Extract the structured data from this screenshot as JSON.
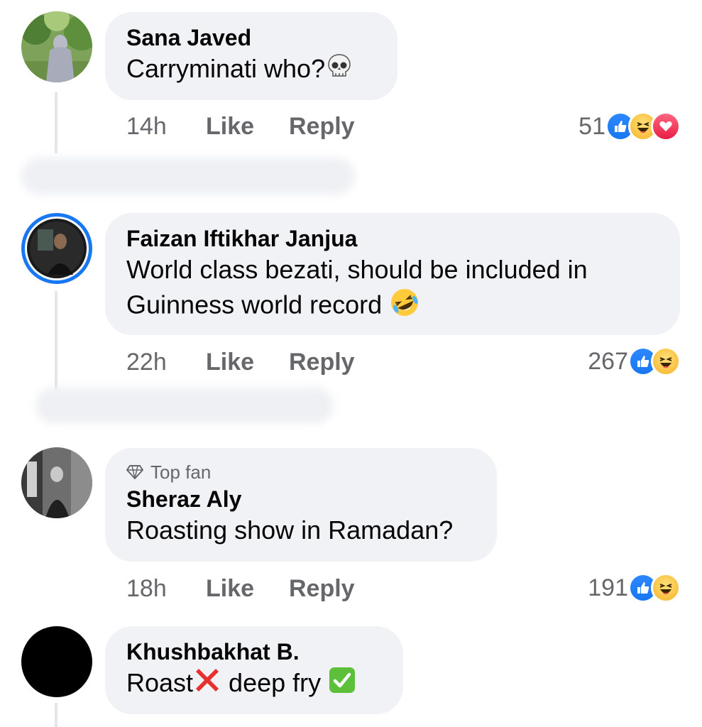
{
  "comments": [
    {
      "author": "Sana Javed",
      "text": "Carryminati who?",
      "text_emoji": "skull-emoji",
      "time": "14h",
      "like_label": "Like",
      "reply_label": "Reply",
      "reaction_count": "51",
      "reactions": [
        "like",
        "haha",
        "love"
      ]
    },
    {
      "author": "Faizan Iftikhar Janjua",
      "text_line1": "World class bezati, should be included in",
      "text_line2": "Guinness world record",
      "text_emoji": "rolling-on-floor-laughing-emoji",
      "time": "22h",
      "like_label": "Like",
      "reply_label": "Reply",
      "reaction_count": "267",
      "reactions": [
        "like",
        "haha"
      ]
    },
    {
      "badge": "Top fan",
      "author": "Sheraz Aly",
      "text": "Roasting show in Ramadan?",
      "time": "18h",
      "like_label": "Like",
      "reply_label": "Reply",
      "reaction_count": "191",
      "reactions": [
        "like",
        "haha"
      ]
    },
    {
      "author": "Khushbakhat B.",
      "text_part1": "Roast",
      "text_part2": " deep fry",
      "text_emojis": [
        "cross-mark-emoji",
        "check-mark-button-emoji"
      ]
    }
  ],
  "colors": {
    "bubble": "#f0f2f5",
    "meta_text": "#65676b",
    "like_blue": "#1877f2",
    "story_ring": "#1877f2"
  }
}
